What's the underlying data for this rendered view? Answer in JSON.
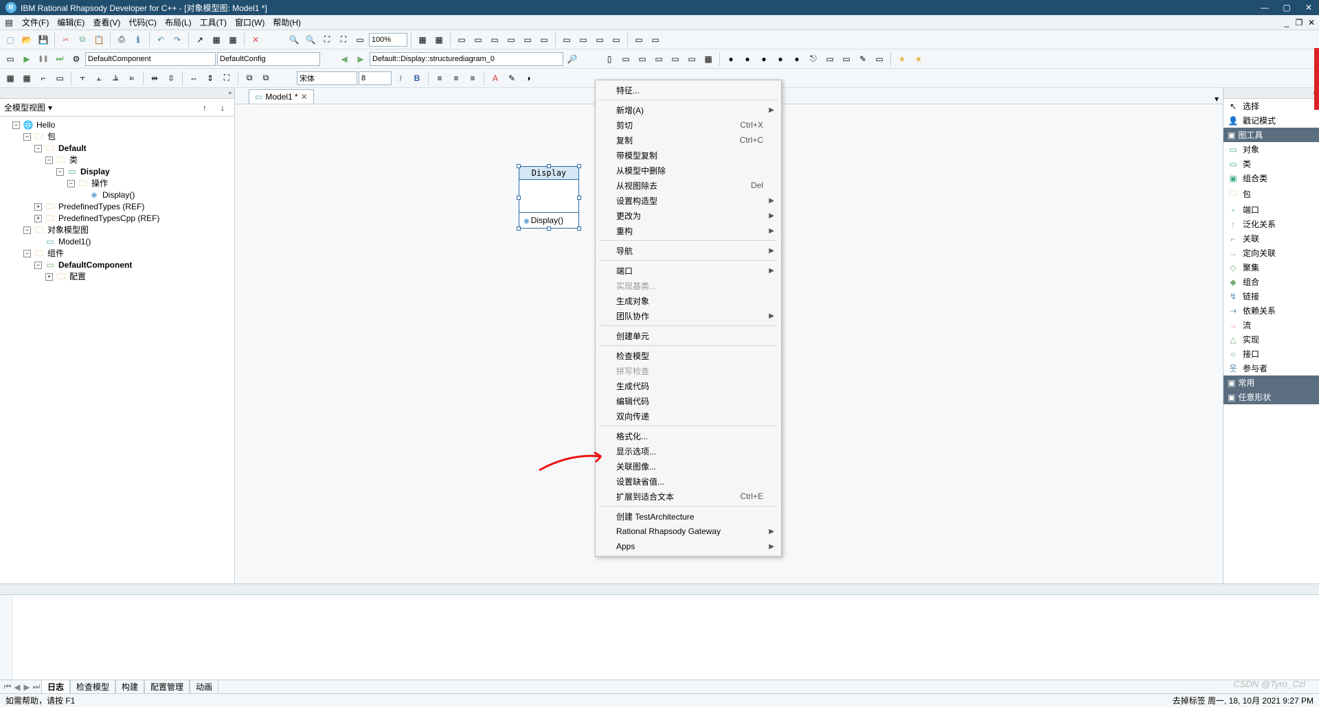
{
  "window": {
    "title": "IBM Rational Rhapsody Developer for C++ - [对象模型图: Model1 *]",
    "icon_letter": "R"
  },
  "menubar": {
    "items": [
      "文件(F)",
      "编辑(E)",
      "查看(V)",
      "代码(C)",
      "布局(L)",
      "工具(T)",
      "窗口(W)",
      "帮助(H)"
    ]
  },
  "toolbar1": {
    "zoom": "100%"
  },
  "toolbar2": {
    "component": "DefaultComponent",
    "config": "DefaultConfig",
    "diagram": "Default::Display::structurediagram_0"
  },
  "toolbar3": {
    "font": "宋体",
    "font_size": "8"
  },
  "left": {
    "view_label": "全模型视图",
    "tree": {
      "root": "Hello",
      "pkg": "包",
      "default": "Default",
      "class_cat": "类",
      "display": "Display",
      "ops": "操作",
      "display_ctor": "Display()",
      "predef": "PredefinedTypes (REF)",
      "predefcpp": "PredefinedTypesCpp (REF)",
      "objdiag": "对象模型图",
      "model1": "Model1()",
      "components": "组件",
      "defcomp": "DefaultComponent",
      "cfgcat": "配置"
    }
  },
  "tab": {
    "label": "Model1 *"
  },
  "classbox": {
    "name": "Display",
    "op": "Display()"
  },
  "palette": {
    "select": "选择",
    "stamp": "戳记模式",
    "hdr_tools": "图工具",
    "object": "对象",
    "class": "类",
    "composite": "组合类",
    "package": "包",
    "port": "端口",
    "generalization": "泛化关系",
    "association": "关联",
    "directed": "定向关联",
    "aggregate": "聚集",
    "composition": "组合",
    "link": "链接",
    "dependency": "依赖关系",
    "flow": "流",
    "realize": "实现",
    "interface": "接口",
    "actor": "参与者",
    "hdr_common": "常用",
    "hdr_shapes": "任意形状"
  },
  "output": {
    "tabs": [
      "日志",
      "检查模型",
      "构建",
      "配置管理",
      "动画"
    ],
    "active": 0
  },
  "status": {
    "left": "如需帮助，请按 F1",
    "right": "去掉标签   周一, 18, 10月 2021  9:27 PM"
  },
  "ctx": {
    "feature": "特征...",
    "new": "新增(A)",
    "cut": "剪切",
    "cut_sc": "Ctrl+X",
    "copy": "复制",
    "copy_sc": "Ctrl+C",
    "copy_model": "带模型复制",
    "del_model": "从模型中删除",
    "del_view": "从视图除去",
    "del_sc": "Del",
    "stereotype": "设置构造型",
    "changeto": "更改为",
    "refactor": "重构",
    "nav": "导航",
    "port": "端口",
    "realize_base": "实现基类...",
    "gen_obj": "生成对象",
    "team": "团队协作",
    "create_unit": "创建单元",
    "check": "检查模型",
    "spell": "拼写检查",
    "gencode": "生成代码",
    "editcode": "编辑代码",
    "roundtrip": "双向传递",
    "format": "格式化...",
    "display_opt": "显示选项...",
    "assoc_img": "关联图像...",
    "defaults": "设置缺省值...",
    "fit": "扩展到适合文本",
    "fit_sc": "Ctrl+E",
    "testarch": "创建 TestArchitecture",
    "gateway": "Rational Rhapsody Gateway",
    "apps": "Apps"
  },
  "watermark": "CSDN @Tyro_Czl"
}
